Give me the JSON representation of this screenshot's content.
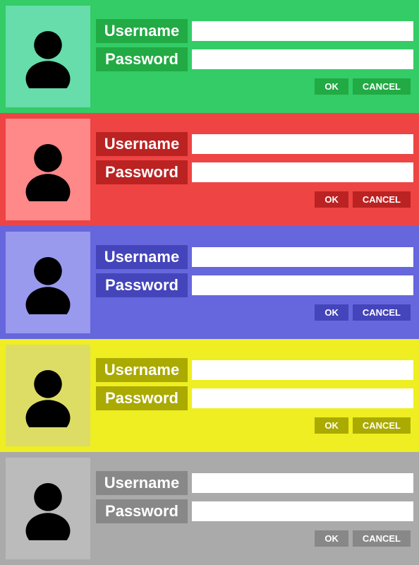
{
  "panels": [
    {
      "id": "green",
      "theme": "panel-green",
      "username_label": "Username",
      "password_label": "Password",
      "ok_label": "OK",
      "cancel_label": "CANCEL"
    },
    {
      "id": "red",
      "theme": "panel-red",
      "username_label": "Username",
      "password_label": "Password",
      "ok_label": "OK",
      "cancel_label": "CANCEL"
    },
    {
      "id": "blue",
      "theme": "panel-blue",
      "username_label": "Username",
      "password_label": "Password",
      "ok_label": "OK",
      "cancel_label": "CANCEL"
    },
    {
      "id": "yellow",
      "theme": "panel-yellow",
      "username_label": "Username",
      "password_label": "Password",
      "ok_label": "OK",
      "cancel_label": "CANCEL"
    },
    {
      "id": "gray",
      "theme": "panel-gray",
      "username_label": "Username",
      "password_label": "Password",
      "ok_label": "OK",
      "cancel_label": "CANCEL"
    }
  ]
}
